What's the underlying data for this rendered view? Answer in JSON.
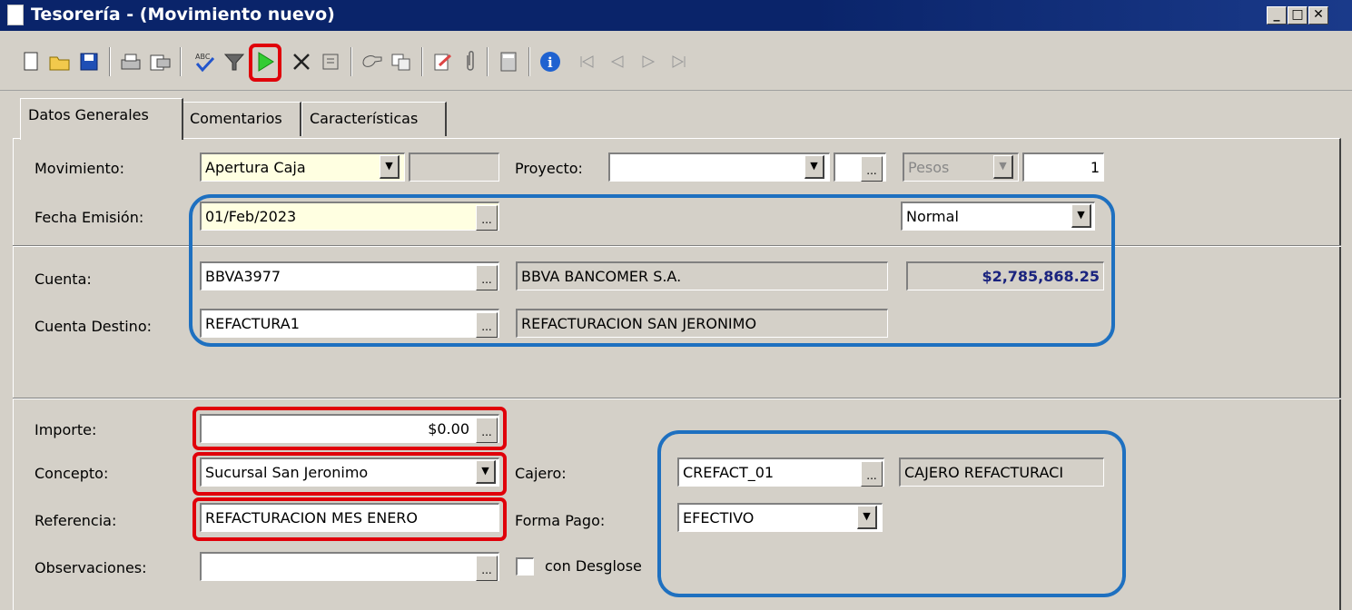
{
  "window": {
    "title": "Tesorería - (Movimiento nuevo)",
    "controls": [
      "minimize-icon",
      "maximize-icon",
      "close-icon"
    ]
  },
  "toolbar": {
    "icons": [
      "new-document-icon",
      "open-folder-icon",
      "save-icon",
      "print-icon",
      "print-preview-icon",
      "spell-check-icon",
      "filter-icon",
      "affect-play-icon",
      "cancel-x-icon",
      "delete-icon",
      "attach-hand-icon",
      "copy-icon",
      "edit-icon",
      "paperclip-icon",
      "calculator-icon",
      "info-icon",
      "first-record-icon",
      "previous-record-icon",
      "next-record-icon",
      "last-record-icon"
    ]
  },
  "tabs": [
    {
      "label": "Datos Generales",
      "active": true
    },
    {
      "label": "Comentarios",
      "active": false
    },
    {
      "label": "Características",
      "active": false
    }
  ],
  "form": {
    "movimiento": {
      "label": "Movimiento:",
      "value": "Apertura Caja"
    },
    "proyecto": {
      "label": "Proyecto:",
      "value": ""
    },
    "moneda": {
      "value": "Pesos"
    },
    "tipo_cambio": {
      "value": "1"
    },
    "fecha_emision": {
      "label": "Fecha Emisión:",
      "value": "01/Feb/2023"
    },
    "prioridad": {
      "value": "Normal"
    },
    "cuenta": {
      "label": "Cuenta:",
      "value": "BBVA3977",
      "name": "BBVA BANCOMER S.A.",
      "balance": "$2,785,868.25"
    },
    "cuenta_destino": {
      "label": "Cuenta Destino:",
      "value": "REFACTURA1",
      "name": "REFACTURACION SAN JERONIMO"
    },
    "importe": {
      "label": "Importe:",
      "value": "$0.00"
    },
    "concepto": {
      "label": "Concepto:",
      "value": "Sucursal San Jeronimo"
    },
    "cajero": {
      "label": "Cajero:",
      "value": "CREFACT_01",
      "name": "CAJERO REFACTURACI"
    },
    "referencia": {
      "label": "Referencia:",
      "value": "REFACTURACION MES ENERO"
    },
    "forma_pago": {
      "label": "Forma Pago:",
      "value": "EFECTIVO"
    },
    "observaciones": {
      "label": "Observaciones:",
      "value": ""
    },
    "con_desglose": {
      "label": "con Desglose",
      "checked": false
    }
  },
  "colors": {
    "title_bar": "#0a246a",
    "highlight_red": "#e0000a",
    "highlight_blue": "#1e70c0",
    "balance_text": "#1a237e",
    "window_bg": "#d4d0c8"
  }
}
